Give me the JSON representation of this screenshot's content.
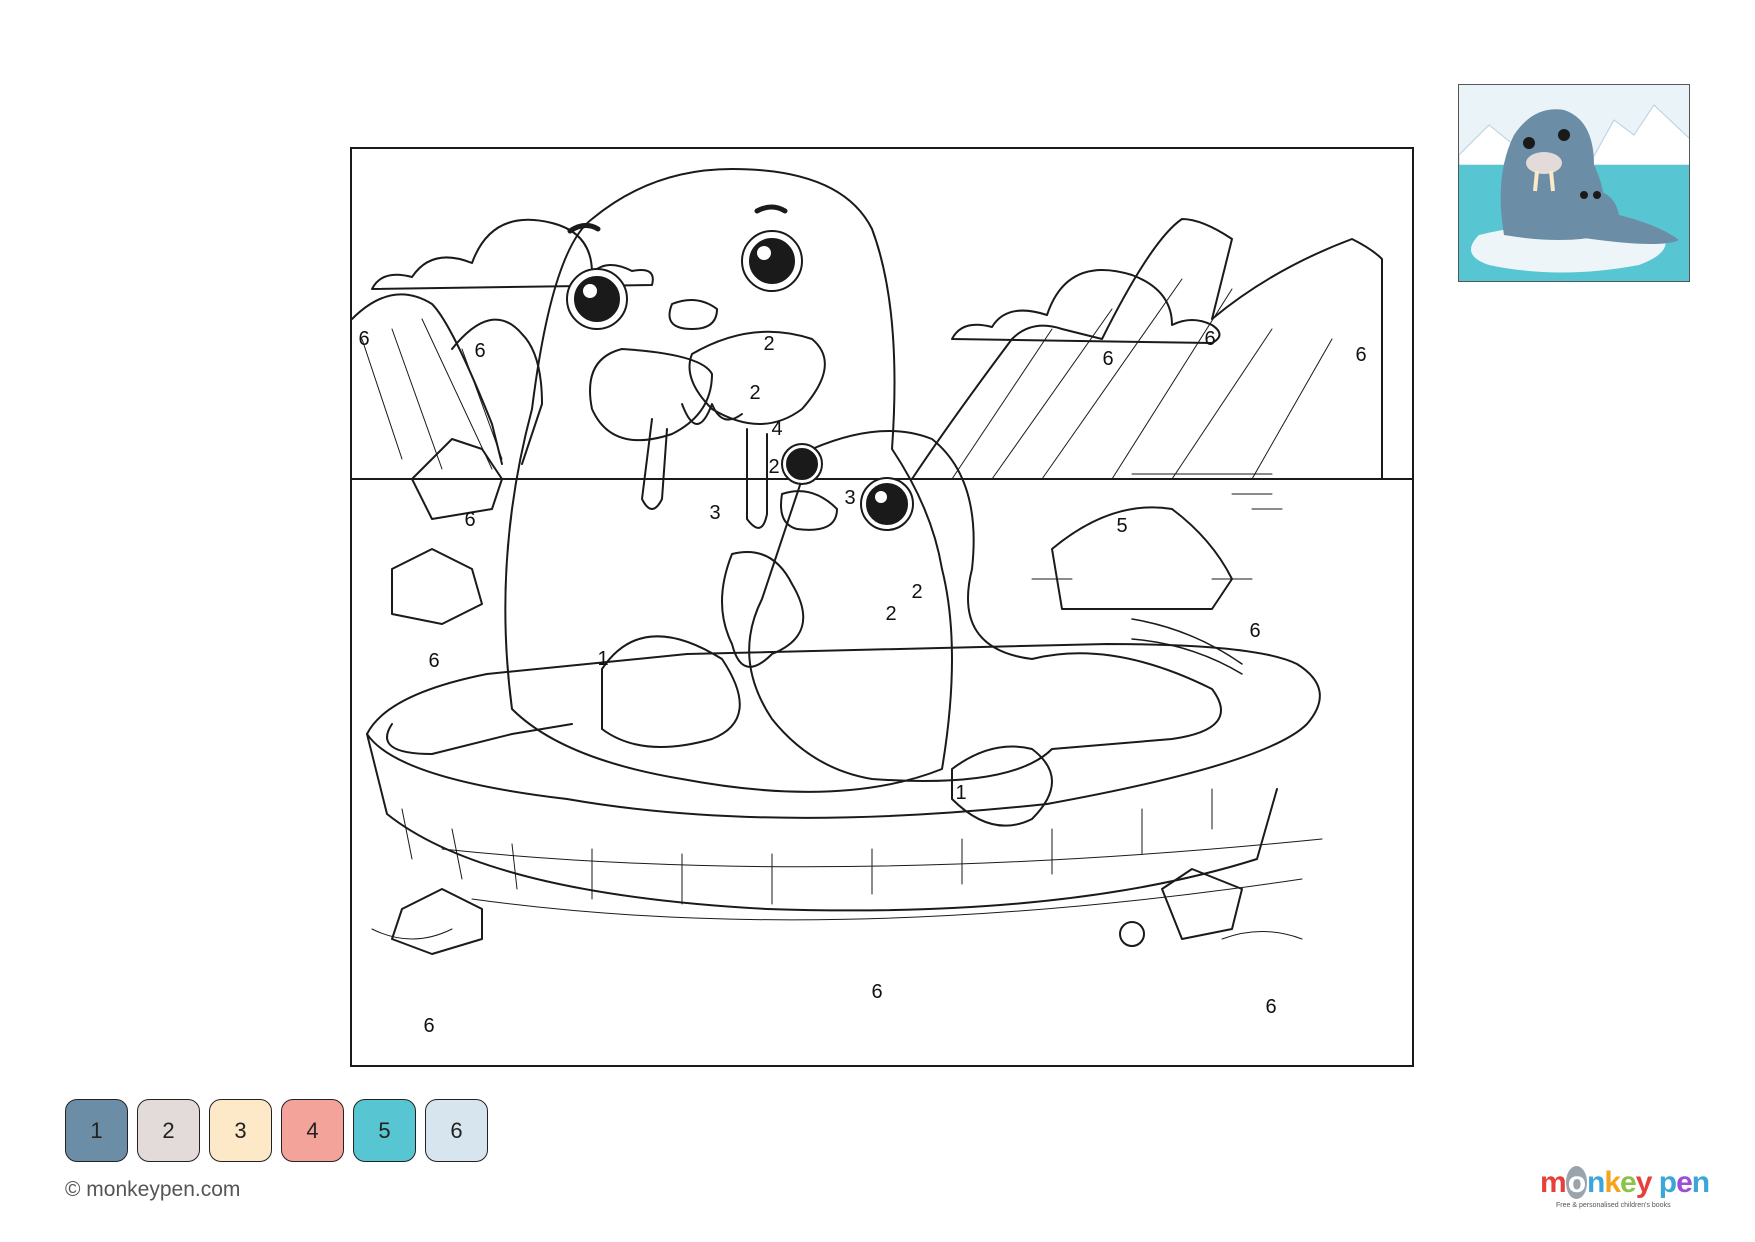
{
  "region_labels": [
    {
      "text": "6"
    },
    {
      "text": "6"
    },
    {
      "text": "2"
    },
    {
      "text": "2"
    },
    {
      "text": "4"
    },
    {
      "text": "2"
    },
    {
      "text": "3"
    },
    {
      "text": "3"
    },
    {
      "text": "6"
    },
    {
      "text": "6"
    },
    {
      "text": "6"
    },
    {
      "text": "6"
    },
    {
      "text": "5"
    },
    {
      "text": "2"
    },
    {
      "text": "2"
    },
    {
      "text": "6"
    },
    {
      "text": "6"
    },
    {
      "text": "1"
    },
    {
      "text": "1"
    },
    {
      "text": "6"
    },
    {
      "text": "6"
    },
    {
      "text": "6"
    }
  ],
  "palette": [
    {
      "number": "1",
      "color": "#6b8ea6"
    },
    {
      "number": "2",
      "color": "#e3dada"
    },
    {
      "number": "3",
      "color": "#fde9c8"
    },
    {
      "number": "4",
      "color": "#f4a39a"
    },
    {
      "number": "5",
      "color": "#57c6d2"
    },
    {
      "number": "6",
      "color": "#d7e6ee"
    }
  ],
  "copyright": "© monkeypen.com",
  "logo": {
    "word_parts": [
      "m",
      "o",
      "n",
      "k",
      "e",
      "y",
      " ",
      "p",
      "e",
      "n"
    ],
    "tagline": "Free & personalised children's books"
  },
  "preview_colors": {
    "sky": "#e9f3f8",
    "sea": "#57c6d2",
    "walrus": "#6b8ea6",
    "ice": "#eef5f9"
  }
}
